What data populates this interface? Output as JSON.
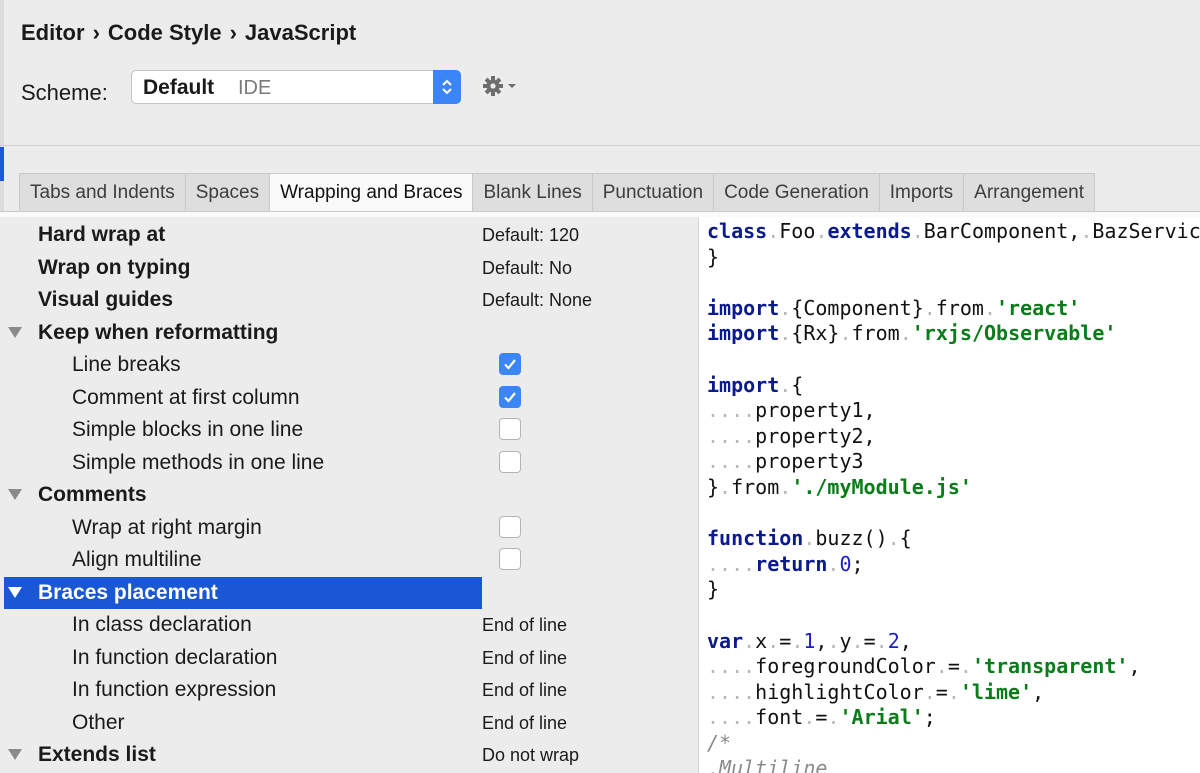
{
  "breadcrumb": [
    "Editor",
    "Code Style",
    "JavaScript"
  ],
  "breadcrumb_separator": "›",
  "scheme": {
    "label": "Scheme:",
    "name": "Default",
    "sub": "IDE"
  },
  "tabs": [
    {
      "label": "Tabs and Indents",
      "active": false
    },
    {
      "label": "Spaces",
      "active": false
    },
    {
      "label": "Wrapping and Braces",
      "active": true
    },
    {
      "label": "Blank Lines",
      "active": false
    },
    {
      "label": "Punctuation",
      "active": false
    },
    {
      "label": "Code Generation",
      "active": false
    },
    {
      "label": "Imports",
      "active": false
    },
    {
      "label": "Arrangement",
      "active": false
    }
  ],
  "options": [
    {
      "label": "Hard wrap at",
      "bold": true,
      "value": "Default: 120"
    },
    {
      "label": "Wrap on typing",
      "bold": true,
      "value": "Default: No"
    },
    {
      "label": "Visual guides",
      "bold": true,
      "value": "Default: None"
    },
    {
      "label": "Keep when reformatting",
      "bold": true,
      "group": true
    },
    {
      "label": "Line breaks",
      "checked": true
    },
    {
      "label": "Comment at first column",
      "checked": true
    },
    {
      "label": "Simple blocks in one line",
      "checked": false
    },
    {
      "label": "Simple methods in one line",
      "checked": false
    },
    {
      "label": "Comments",
      "bold": true,
      "group": true
    },
    {
      "label": "Wrap at right margin",
      "checked": false
    },
    {
      "label": "Align multiline",
      "checked": false
    },
    {
      "label": "Braces placement",
      "bold": true,
      "group": true,
      "selected": true
    },
    {
      "label": "In class declaration",
      "value": "End of line"
    },
    {
      "label": "In function declaration",
      "value": "End of line"
    },
    {
      "label": "In function expression",
      "value": "End of line"
    },
    {
      "label": "Other",
      "value": "End of line"
    },
    {
      "label": "Extends list",
      "bold": true,
      "group": true,
      "value": "Do not wrap"
    }
  ],
  "code_lines": [
    [
      [
        "kw",
        "class"
      ],
      [
        "ws",
        "."
      ],
      [
        "t",
        "Foo"
      ],
      [
        "ws",
        "."
      ],
      [
        "kw",
        "extends"
      ],
      [
        "ws",
        "."
      ],
      [
        "t",
        "BarComponent,"
      ],
      [
        "ws",
        "."
      ],
      [
        "t",
        "BazService"
      ]
    ],
    [
      [
        "t",
        "}"
      ]
    ],
    [],
    [
      [
        "kw",
        "import"
      ],
      [
        "ws",
        "."
      ],
      [
        "t",
        "{Component}"
      ],
      [
        "ws",
        "."
      ],
      [
        "t",
        "from"
      ],
      [
        "ws",
        "."
      ],
      [
        "str",
        "'react'"
      ]
    ],
    [
      [
        "kw",
        "import"
      ],
      [
        "ws",
        "."
      ],
      [
        "t",
        "{Rx}"
      ],
      [
        "ws",
        "."
      ],
      [
        "t",
        "from"
      ],
      [
        "ws",
        "."
      ],
      [
        "str",
        "'rxjs/Observable'"
      ]
    ],
    [],
    [
      [
        "kw",
        "import"
      ],
      [
        "ws",
        "."
      ],
      [
        "t",
        "{"
      ]
    ],
    [
      [
        "ws",
        "...."
      ],
      [
        "t",
        "property1,"
      ]
    ],
    [
      [
        "ws",
        "...."
      ],
      [
        "t",
        "property2,"
      ]
    ],
    [
      [
        "ws",
        "...."
      ],
      [
        "t",
        "property3"
      ]
    ],
    [
      [
        "t",
        "}"
      ],
      [
        "ws",
        "."
      ],
      [
        "t",
        "from"
      ],
      [
        "ws",
        "."
      ],
      [
        "str",
        "'./myModule.js'"
      ]
    ],
    [],
    [
      [
        "kw",
        "function"
      ],
      [
        "ws",
        "."
      ],
      [
        "t",
        "buzz()"
      ],
      [
        "ws",
        "."
      ],
      [
        "t",
        "{"
      ]
    ],
    [
      [
        "ws",
        "...."
      ],
      [
        "kw",
        "return"
      ],
      [
        "ws",
        "."
      ],
      [
        "num",
        "0"
      ],
      [
        "t",
        ";"
      ]
    ],
    [
      [
        "t",
        "}"
      ]
    ],
    [],
    [
      [
        "kw",
        "var"
      ],
      [
        "ws",
        "."
      ],
      [
        "t",
        "x"
      ],
      [
        "ws",
        "."
      ],
      [
        "t",
        "="
      ],
      [
        "ws",
        "."
      ],
      [
        "num",
        "1"
      ],
      [
        "t",
        ","
      ],
      [
        "ws",
        "."
      ],
      [
        "t",
        "y"
      ],
      [
        "ws",
        "."
      ],
      [
        "t",
        "="
      ],
      [
        "ws",
        "."
      ],
      [
        "num",
        "2"
      ],
      [
        "t",
        ","
      ]
    ],
    [
      [
        "ws",
        "...."
      ],
      [
        "t",
        "foregroundColor"
      ],
      [
        "ws",
        "."
      ],
      [
        "t",
        "="
      ],
      [
        "ws",
        "."
      ],
      [
        "str",
        "'transparent'"
      ],
      [
        "t",
        ","
      ]
    ],
    [
      [
        "ws",
        "...."
      ],
      [
        "t",
        "highlightColor"
      ],
      [
        "ws",
        "."
      ],
      [
        "t",
        "="
      ],
      [
        "ws",
        "."
      ],
      [
        "str",
        "'lime'"
      ],
      [
        "t",
        ","
      ]
    ],
    [
      [
        "ws",
        "...."
      ],
      [
        "t",
        "font"
      ],
      [
        "ws",
        "."
      ],
      [
        "t",
        "="
      ],
      [
        "ws",
        "."
      ],
      [
        "str",
        "'Arial'"
      ],
      [
        "t",
        ";"
      ]
    ],
    [
      [
        "cmt",
        "/*"
      ]
    ],
    [
      [
        "ws",
        "."
      ],
      [
        "cmt",
        "Multiline"
      ]
    ]
  ],
  "colors": {
    "accent": "#1a57d4",
    "checkbox": "#3a86f6",
    "keyword": "#0b1a8e",
    "string": "#0a7d1a",
    "number": "#1c1ccc"
  }
}
